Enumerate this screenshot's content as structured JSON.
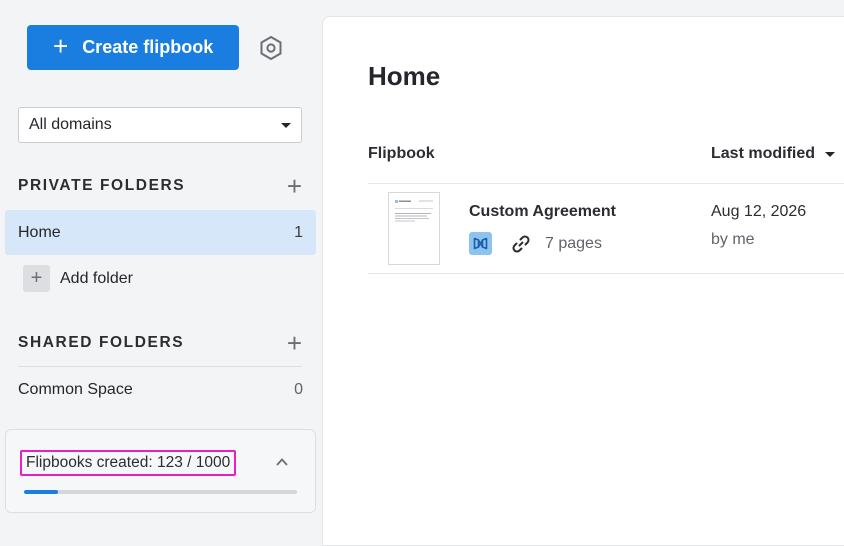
{
  "sidebar": {
    "create_button_label": "Create flipbook",
    "domain_select": {
      "value": "All domains"
    },
    "private_folders": {
      "title": "PRIVATE FOLDERS",
      "items": [
        {
          "label": "Home",
          "count": "1",
          "active": true
        }
      ],
      "add_folder_label": "Add folder"
    },
    "shared_folders": {
      "title": "SHARED FOLDERS",
      "items": [
        {
          "label": "Common Space",
          "count": "0",
          "active": false
        }
      ]
    },
    "quota": {
      "label": "Flipbooks created: 123 / 1000",
      "used": 123,
      "total": 1000
    }
  },
  "main": {
    "title": "Home",
    "columns": {
      "flipbook": "Flipbook",
      "last_modified": "Last modified"
    },
    "rows": [
      {
        "title": "Custom Agreement",
        "pages": "7 pages",
        "date": "Aug 12, 2026",
        "owner": "by me"
      }
    ]
  },
  "colors": {
    "accent": "#1a7ee0",
    "active_row": "#d5e7f8",
    "highlight": "#e91ec6"
  },
  "icons": [
    "plus-icon",
    "settings-icon",
    "chevron-down-icon",
    "chevron-up-icon",
    "flipbook-icon",
    "link-icon"
  ]
}
